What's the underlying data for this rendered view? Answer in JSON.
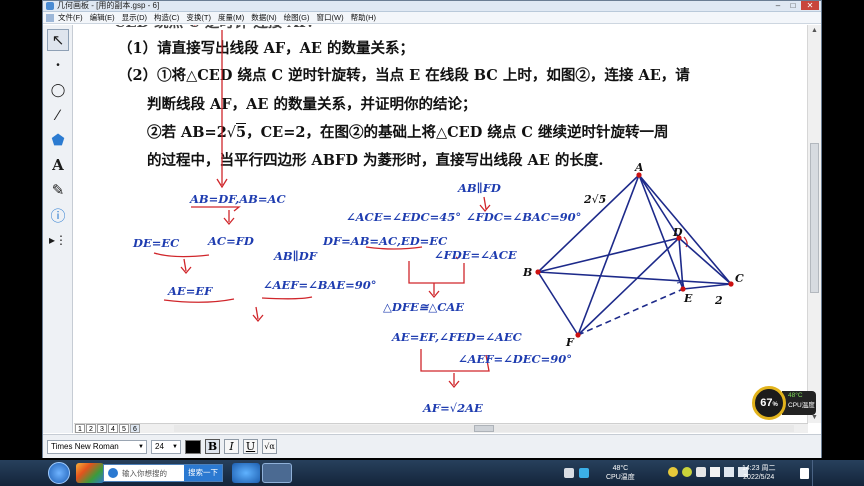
{
  "window": {
    "title": "几何画板 - [用的副本.gsp - 6]",
    "controls": [
      "–",
      "□",
      "✕"
    ]
  },
  "menubar": {
    "items": [
      "文件(F)",
      "编辑(E)",
      "显示(D)",
      "构造(C)",
      "变换(T)",
      "度量(M)",
      "数据(N)",
      "绘图(G)",
      "窗口(W)",
      "帮助(H)"
    ]
  },
  "toolbox": {
    "tools": [
      {
        "name": "arrow-select-tool",
        "glyph": "↖"
      },
      {
        "name": "point-tool",
        "glyph": "•"
      },
      {
        "name": "compass-tool",
        "glyph": "◯"
      },
      {
        "name": "straightedge-tool",
        "glyph": "∕"
      },
      {
        "name": "polygon-tool",
        "glyph": "⬟"
      },
      {
        "name": "text-tool",
        "glyph": "A"
      },
      {
        "name": "marker-tool",
        "glyph": "✎"
      },
      {
        "name": "information-tool",
        "glyph": "ⓘ"
      },
      {
        "name": "custom-tool",
        "glyph": "▸⋮"
      }
    ]
  },
  "problem": {
    "partial_top": "CED 绕点 C 逆时针 连接 AF.",
    "q1": "（1）请直接写出线段 AF，AE 的数量关系；",
    "q2_line1": "（2）①将△CED 绕点 C 逆时针旋转，当点 E 在线段 BC 上时，如图②，连接 AE，请",
    "q2_line2": "判断线段 AF，AE 的数量关系，并证明你的结论；",
    "q2_line3_pre": "②若 AB=2",
    "q2_line3_sqrt": "5",
    "q2_line3_post": "，CE=2，在图②的基础上将△CED 绕点 C 继续逆时针旋转一周",
    "q2_line4": "的过程中，当平行四边形 ABFD 为菱形时，直接写出线段 AE 的长度."
  },
  "annotations": {
    "ab_df_ab_ac": "AB=DF,AB=AC",
    "de_ec": "DE=EC",
    "ac_fd": "AC=FD",
    "ae_ef": "AE=EF",
    "ab_par_df": "AB∥DF",
    "aef_bae": "∠AEF=∠BAE=90°",
    "ab_par_fd": "AB∥FD",
    "ace_edc": "∠ACE=∠EDC=45°",
    "fdc_bac": "∠FDC=∠BAC=90°",
    "df_ab_ac_ed_ec": "DF=AB=AC,ED=EC",
    "fde_ace": "∠FDE=∠ACE",
    "dfe_cae": "△DFE≅△CAE",
    "ae_ef_fed_aec": "AE=EF,∠FED=∠AEC",
    "aef_dec": "∠AEF=∠DEC=90°",
    "af_result_pre": "AF=",
    "af_result_sqrt": "2",
    "af_result_post": "AE"
  },
  "figure": {
    "labels": {
      "A": "A",
      "B": "B",
      "C": "C",
      "D": "D",
      "E": "E",
      "F": "F"
    },
    "side_ab_pre": "2",
    "side_ab_sqrt": "5",
    "side_ce": "2",
    "colors": {
      "lines": "#1d2a8a",
      "points": "#cc1111",
      "annotation": "#1f3db0",
      "strokes_red": "#d0262b"
    }
  },
  "pages": {
    "tabs": [
      "1",
      "2",
      "3",
      "4",
      "5",
      "6"
    ]
  },
  "textbar": {
    "font": "Times New Roman",
    "size": "24",
    "bold": "B",
    "italic": "I",
    "underline": "U",
    "symbol": "√α"
  },
  "taskbar": {
    "search_placeholder": "输入你想搜的",
    "search_button": "搜索一下",
    "cpu_temp": "48°C",
    "cpu_label": "CPU温度",
    "time": "14:23 周二",
    "date": "2022/5/24"
  },
  "cpu_widget": {
    "percent": "67",
    "percent_unit": "%",
    "temp": "48°C",
    "label": "CPU温度"
  }
}
